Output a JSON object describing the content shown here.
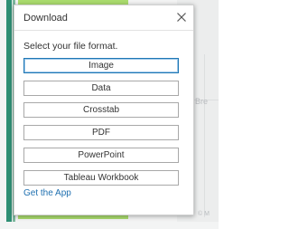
{
  "background": {
    "map_label_1": "Bre",
    "map_label_2": "© M"
  },
  "dialog": {
    "title": "Download",
    "close_icon": "close-icon",
    "instruction": "Select your file format.",
    "formats": [
      {
        "label": "Image",
        "selected": true
      },
      {
        "label": "Data",
        "selected": false
      },
      {
        "label": "Crosstab",
        "selected": false
      },
      {
        "label": "PDF",
        "selected": false
      },
      {
        "label": "PowerPoint",
        "selected": false
      },
      {
        "label": "Tableau Workbook",
        "selected": false
      }
    ],
    "get_app_link": "Get the App"
  },
  "colors": {
    "accent": "#1f70b0",
    "selected_border": "#1f77b4",
    "green_bar": "#aadc6e",
    "teal_strip": "#2f8f74"
  }
}
